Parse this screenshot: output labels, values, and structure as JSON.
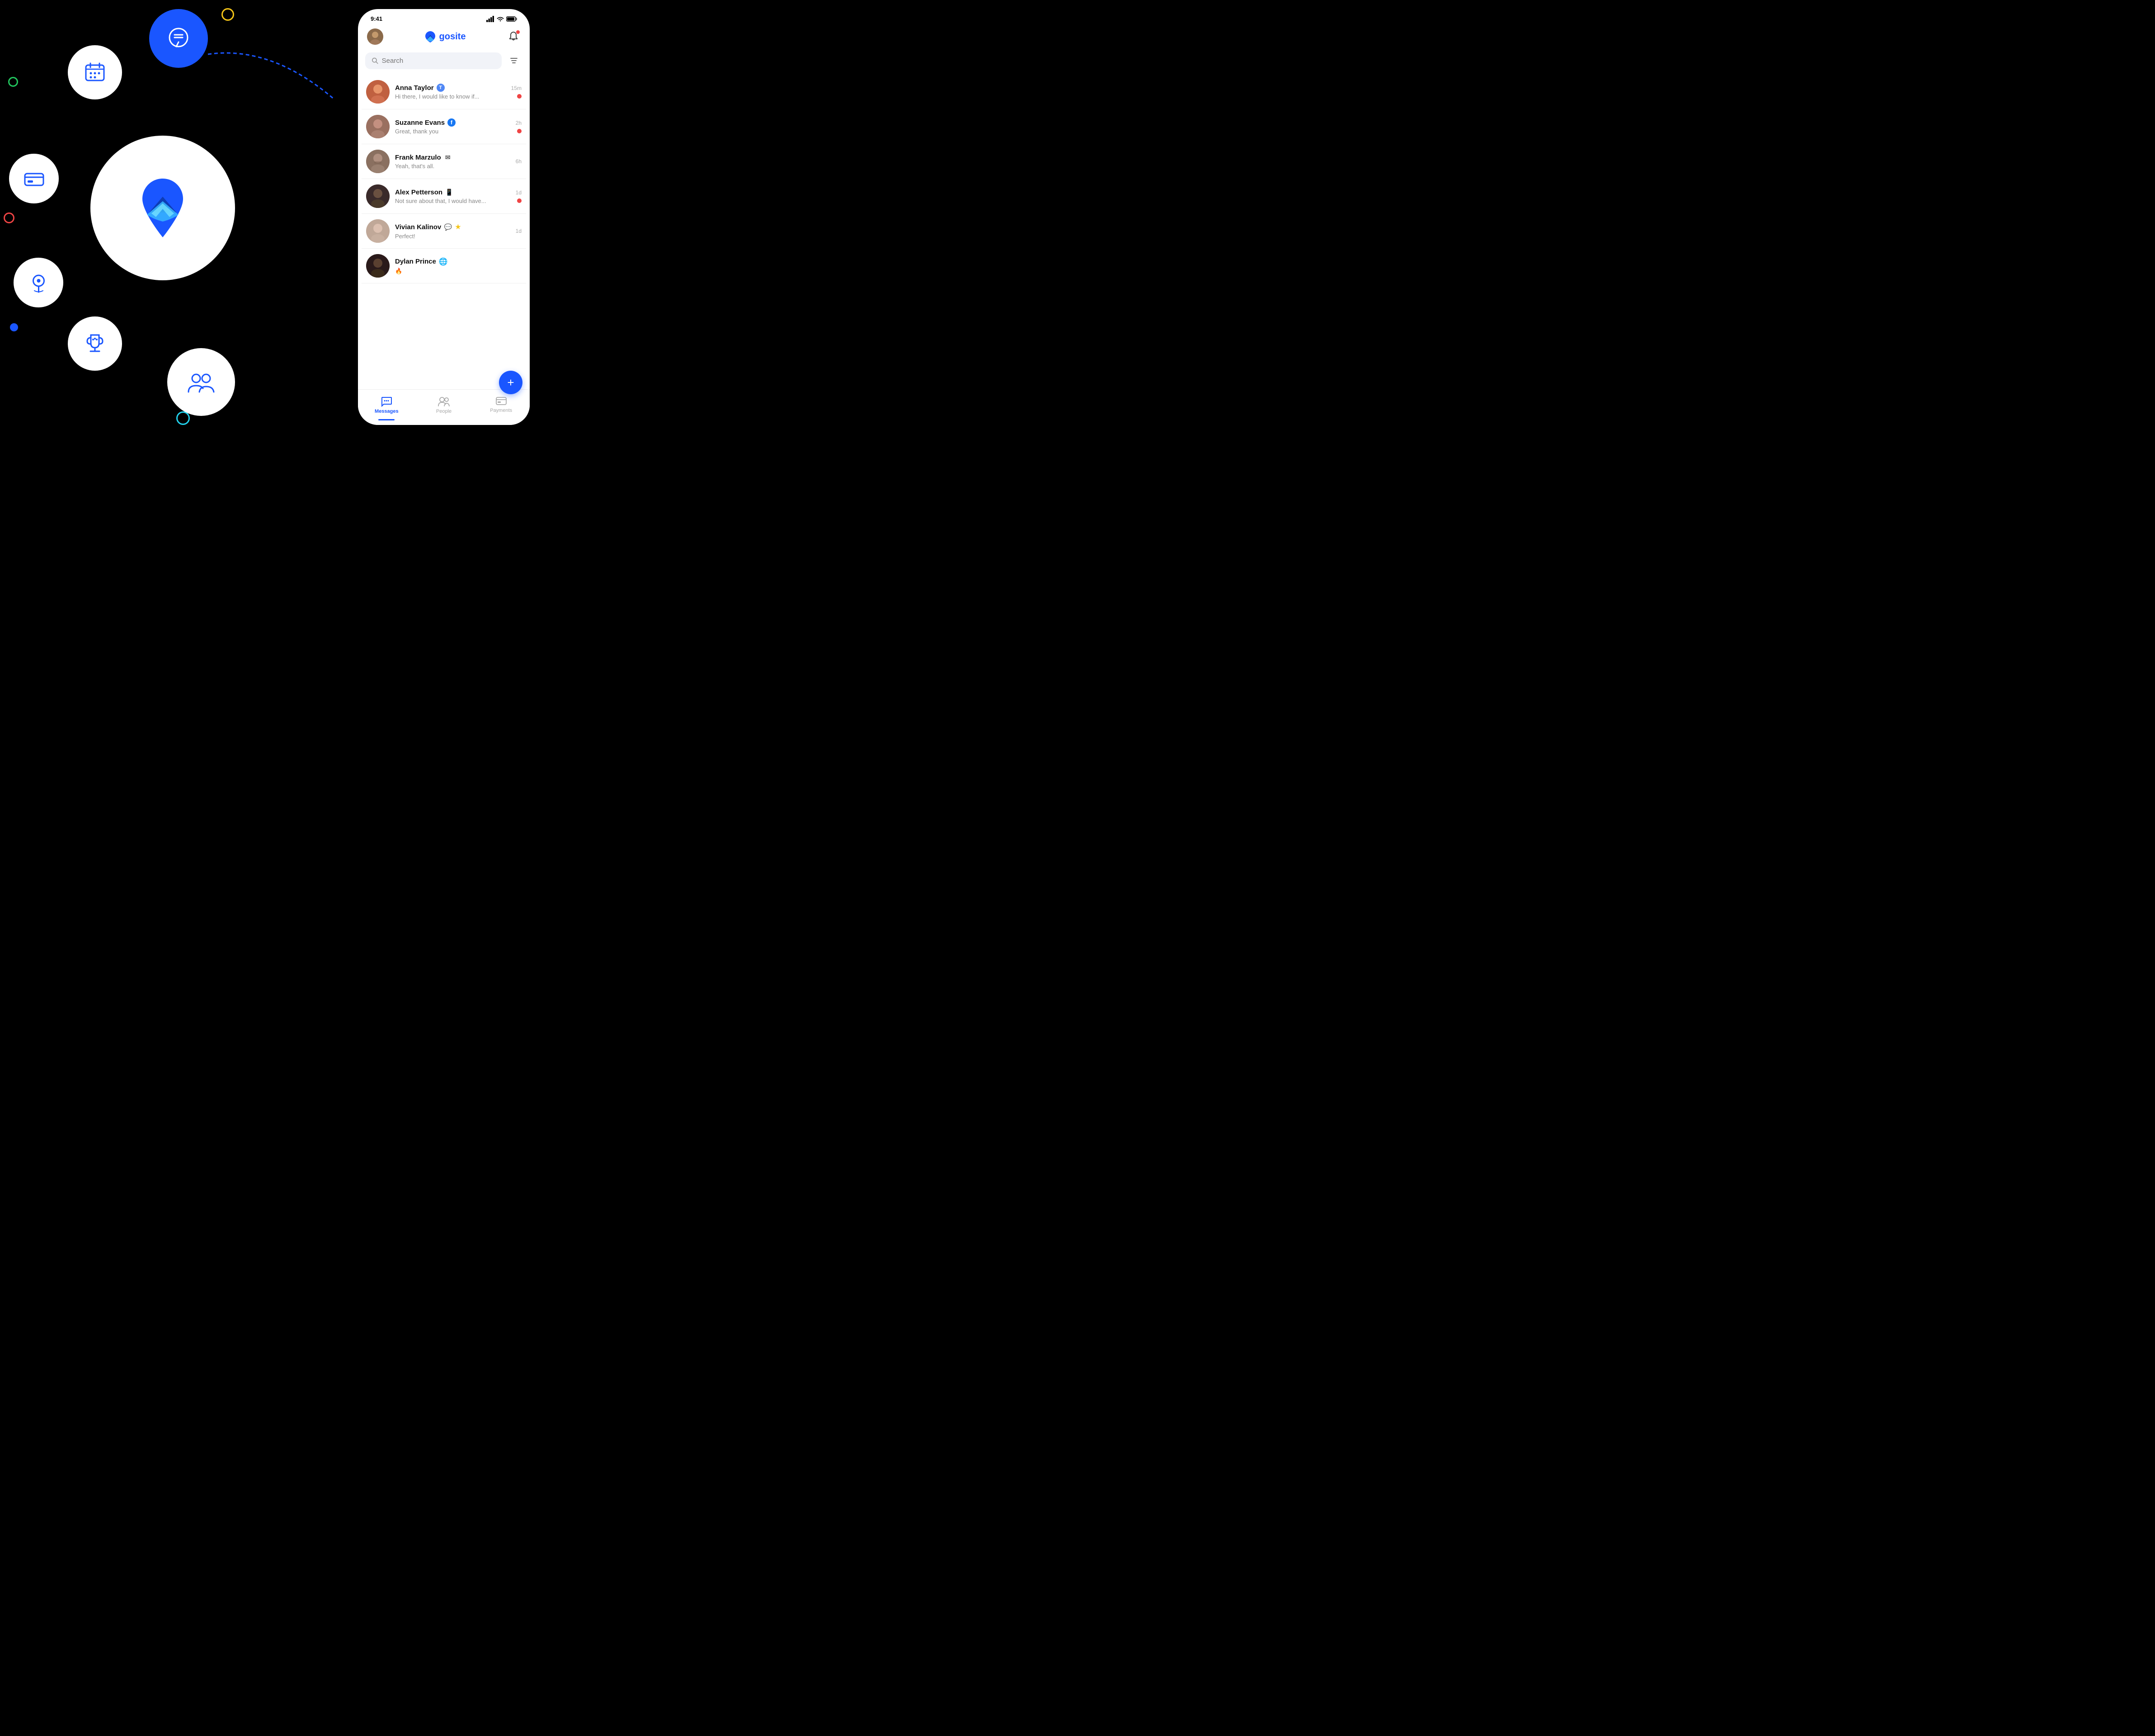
{
  "background": "#000000",
  "decorative": {
    "dots": [
      {
        "color": "#f5c518",
        "type": "ring"
      },
      {
        "color": "#22c55e",
        "type": "ring"
      },
      {
        "color": "#ef4444",
        "type": "ring"
      },
      {
        "color": "#1a56ff",
        "type": "solid"
      },
      {
        "color": "#22d3ee",
        "type": "ring"
      }
    ]
  },
  "phone": {
    "status_bar": {
      "time": "9:41",
      "signal": "●●●●",
      "wifi": "wifi",
      "battery": "battery"
    },
    "app_name": "gosite",
    "search_placeholder": "Search",
    "filter_icon": "filter",
    "bell_icon": "bell",
    "conversations": [
      {
        "name": "Anna Taylor",
        "channel": "T",
        "channel_type": "text",
        "preview": "Hi there, I would like to know if...",
        "time": "15m",
        "unread": true,
        "avatar_color": "#c06040"
      },
      {
        "name": "Suzanne Evans",
        "channel": "f",
        "channel_type": "facebook",
        "preview": "Great, thank you",
        "time": "2h",
        "unread": true,
        "avatar_color": "#9a6a5a"
      },
      {
        "name": "Frank Marzulo",
        "channel": "✉",
        "channel_type": "email",
        "preview": "Yeah, that's all.",
        "time": "6h",
        "unread": false,
        "avatar_color": "#7a6050"
      },
      {
        "name": "Alex Petterson",
        "channel": "□",
        "channel_type": "sms",
        "preview": "Not sure about that, I would have...",
        "time": "1d",
        "unread": true,
        "avatar_color": "#3a2a2a"
      },
      {
        "name": "Vivian Kalinov",
        "channel": "💬",
        "channel_type": "chat",
        "preview": "Perfect!",
        "time": "1d",
        "unread": false,
        "star": true,
        "avatar_color": "#a89888"
      },
      {
        "name": "Dylan Prince",
        "channel": "🌐",
        "channel_type": "web",
        "preview": "🔥",
        "time": "",
        "unread": false,
        "avatar_color": "#2a1a1a"
      }
    ],
    "fab_label": "+",
    "tabs": [
      {
        "label": "Messages",
        "icon": "messages",
        "active": true
      },
      {
        "label": "People",
        "icon": "people",
        "active": false
      },
      {
        "label": "Payments",
        "icon": "payments",
        "active": false
      }
    ]
  },
  "icon_circles": [
    {
      "name": "chat",
      "bg": "#1a56ff",
      "icon": "chat-bubble"
    },
    {
      "name": "calendar",
      "bg": "#ffffff",
      "icon": "calendar"
    },
    {
      "name": "card",
      "bg": "#ffffff",
      "icon": "credit-card"
    },
    {
      "name": "location",
      "bg": "#ffffff",
      "icon": "location-pin"
    },
    {
      "name": "trophy",
      "bg": "#ffffff",
      "icon": "trophy"
    },
    {
      "name": "people",
      "bg": "#ffffff",
      "icon": "people-group"
    }
  ]
}
